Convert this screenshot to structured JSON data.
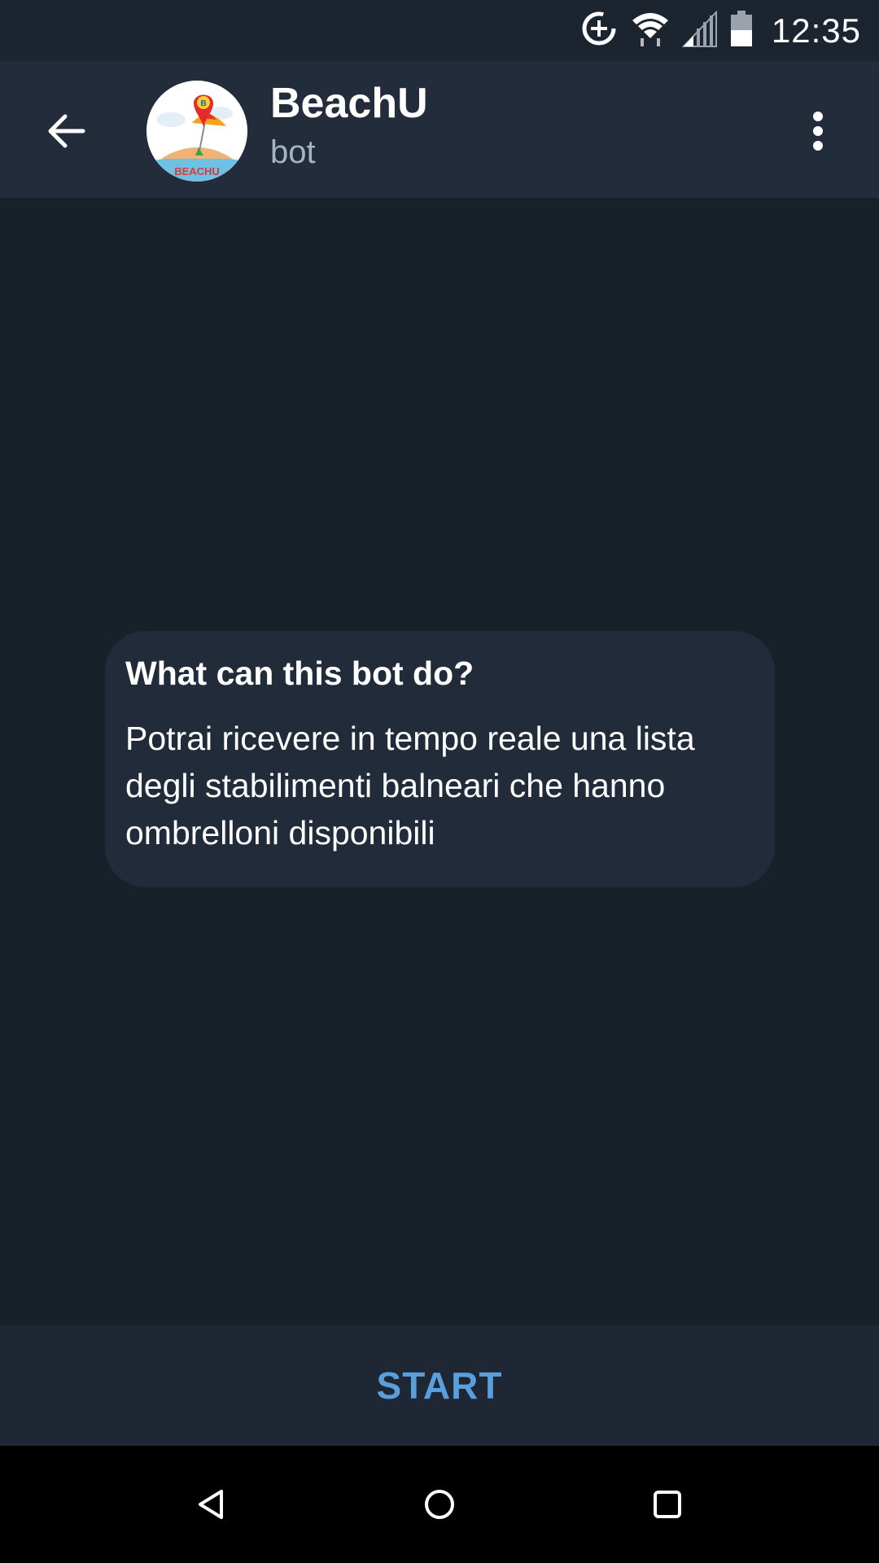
{
  "status_bar": {
    "time": "12:35",
    "icons": [
      "data-saver-icon",
      "wifi-icon",
      "signal-icon",
      "battery-icon"
    ]
  },
  "header": {
    "title": "BeachU",
    "subtitle": "bot",
    "avatar_text": "BEACHU",
    "avatar_pin_letter": "B",
    "icons": [
      "back-arrow-icon",
      "more-vert-icon"
    ]
  },
  "bot_info": {
    "title": "What can this bot do?",
    "description": "Potrai ricevere in tempo reale una lista degli stabilimenti balneari che hanno ombrelloni disponibili"
  },
  "start_button": {
    "label": "START"
  },
  "nav_bar": {
    "icons": [
      "back-triangle-icon",
      "home-circle-icon",
      "recents-square-icon"
    ]
  },
  "colors": {
    "background": "#18202a",
    "header": "#222c3b",
    "card": "#212b39",
    "accent": "#5a9fdc"
  }
}
